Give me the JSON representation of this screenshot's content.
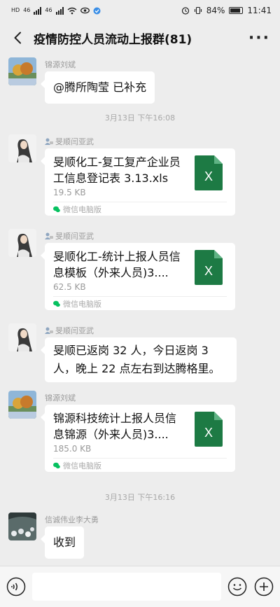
{
  "status_bar": {
    "left_marks": [
      "HD",
      "46",
      "46"
    ],
    "battery": "84%",
    "battery_level": 0.84,
    "time": "11:41"
  },
  "header": {
    "title": "疫情防控人员流动上报群(81)"
  },
  "messages": [
    {
      "sender": "锦源刘斌",
      "text": "@腾所陶莹  已补充"
    },
    {
      "sender": "旻顺闫亚武",
      "file": {
        "name": "旻顺化工-复工复产企业员工信息登记表 3.13.xls",
        "size": "19.5 KB",
        "source": "微信电脑版",
        "icon_letter": "X"
      }
    },
    {
      "sender": "旻顺闫亚武",
      "file": {
        "name": "旻顺化工-统计上报人员信息模板（外来人员)3....",
        "size": "62.5 KB",
        "source": "微信电脑版",
        "icon_letter": "X"
      }
    },
    {
      "sender": "旻顺闫亚武",
      "text": "旻顺已返岗 32 人，今日返岗 3 人，晚上 22 点左右到达腾格里。"
    },
    {
      "sender": "锦源刘斌",
      "file": {
        "name": "锦源科技统计上报人员信息锦源（外来人员)3....",
        "size": "185.0 KB",
        "source": "微信电脑版",
        "icon_letter": "X"
      }
    },
    {
      "sender": "信诚伟业李大勇",
      "text": "收到"
    }
  ],
  "timestamps": [
    "3月13日 下午16:08",
    "3月13日 下午16:16"
  ],
  "colors": {
    "background": "#ededed",
    "bubble": "#ffffff",
    "excel_green": "#1d7a44",
    "wechat_green": "#07c160"
  },
  "icons": {
    "back": "chevron-left-icon",
    "more": "more-icon",
    "voice": "voice-icon",
    "emoji": "emoji-icon",
    "plus": "plus-icon",
    "file": "excel-icon"
  }
}
